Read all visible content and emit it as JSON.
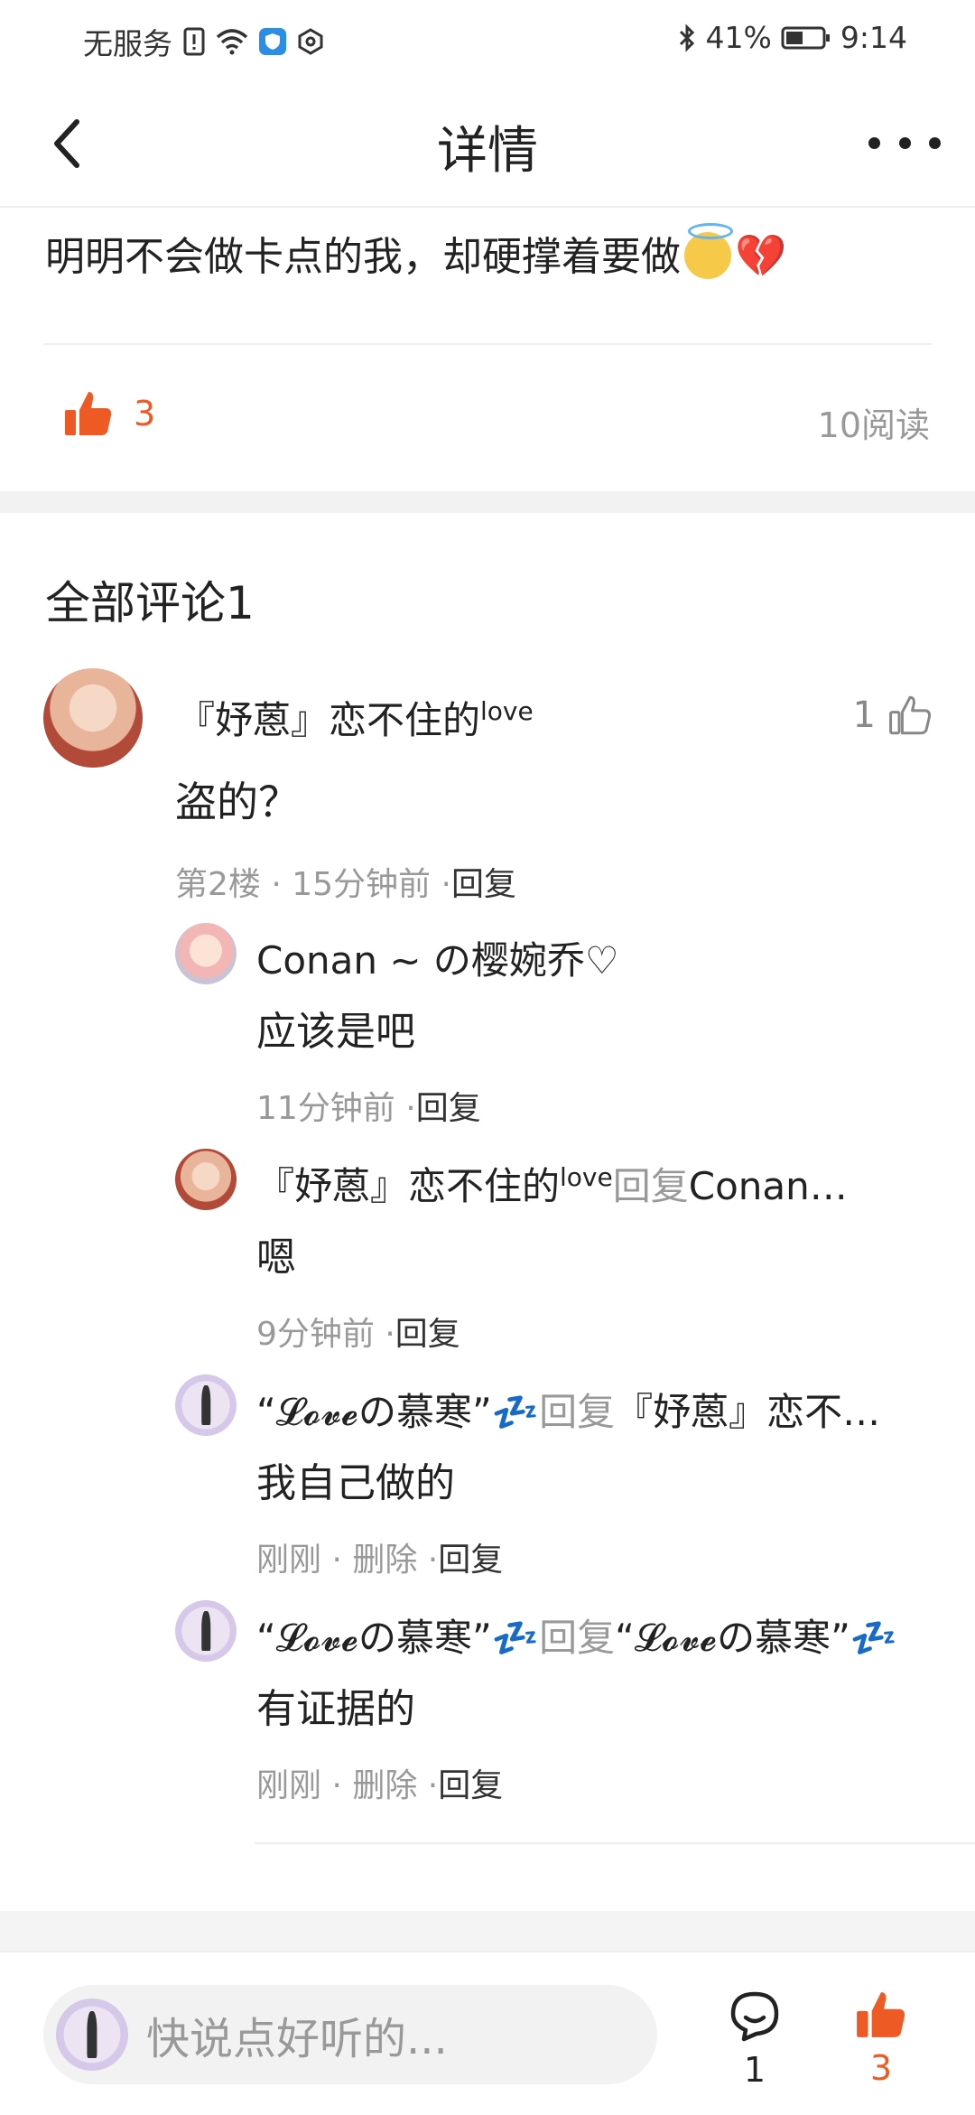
{
  "status_bar": {
    "carrier": "无服务",
    "battery": "41%",
    "time": "9:14"
  },
  "header": {
    "title": "详情"
  },
  "post": {
    "text": "明明不会做卡点的我，却硬撑着要做",
    "likes": "3",
    "reads": "10阅读"
  },
  "comments_section": {
    "title": "全部评论1"
  },
  "comment": {
    "author": "『妤蒽』恋不住的",
    "author_sup": "love",
    "body": "盗的？",
    "meta": "第2楼 · 15分钟前 ·",
    "reply_label": "回复",
    "likes": "1"
  },
  "replies": [
    {
      "author": "Conan ~ の樱婉乔♡",
      "author_sup": "",
      "reply_to_label": "",
      "reply_to": "",
      "body": "应该是吧",
      "meta": "11分钟前 ·",
      "reply_label": "回复"
    },
    {
      "author": "『妤蒽』恋不住的",
      "author_sup": "love",
      "reply_to_label": "回复",
      "reply_to": "Conan…",
      "body": "嗯",
      "meta": "9分钟前 ·",
      "reply_label": "回复"
    },
    {
      "author": "“𝓛𝓸𝓿𝓮の慕寒”💤",
      "author_sup": "",
      "reply_to_label": "回复",
      "reply_to": "『妤蒽』恋不…",
      "body": "我自己做的",
      "meta": "刚刚 · 删除 ·",
      "reply_label": "回复"
    },
    {
      "author": "“𝓛𝓸𝓿𝓮の慕寒”💤",
      "author_sup": "",
      "reply_to_label": "回复",
      "reply_to": "“𝓛𝓸𝓿𝓮の慕寒”💤",
      "body": "有证据的",
      "meta": "刚刚 · 删除 ·",
      "reply_label": "回复"
    }
  ],
  "bottom_bar": {
    "input_placeholder": "快说点好听的...",
    "comment_count": "1",
    "like_count": "3"
  },
  "colors": {
    "accent": "#ee5a24",
    "muted": "#999999"
  }
}
